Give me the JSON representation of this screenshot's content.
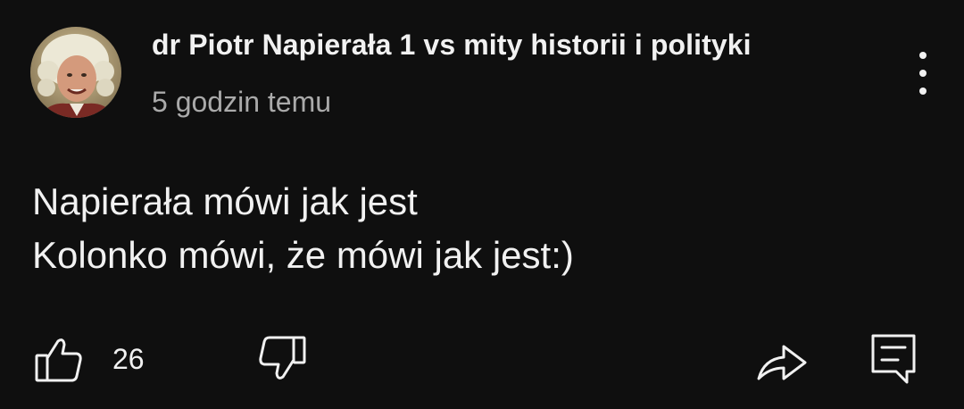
{
  "comment": {
    "author": "dr Piotr Napierała 1 vs mity historii i polityki",
    "timestamp": "5 godzin temu",
    "text_lines": [
      "Napierała mówi jak jest",
      "Kolonko mówi, że mówi jak jest:)"
    ],
    "like_count": "26"
  },
  "icons": {
    "menu": "more-vertical-icon",
    "like": "thumbs-up-icon",
    "dislike": "thumbs-down-icon",
    "share": "share-arrow-icon",
    "reply": "comment-reply-icon"
  },
  "colors": {
    "background": "#0f0f0f",
    "text_primary": "#f1f1f1",
    "text_secondary": "#aaaaaa"
  }
}
